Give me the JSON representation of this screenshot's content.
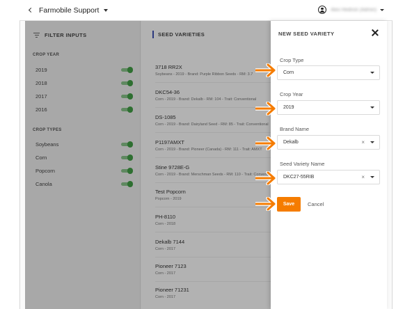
{
  "topbar": {
    "title": "Farmobile Support",
    "user_name": "Alex Hedrick (Admin)"
  },
  "sidebar": {
    "title": "FILTER INPUTS",
    "crop_year_label": "CROP YEAR",
    "crop_years": [
      "2019",
      "2018",
      "2017",
      "2016"
    ],
    "crop_types_label": "CROP TYPES",
    "crop_types": [
      "Soybeans",
      "Corn",
      "Popcorn",
      "Canola"
    ]
  },
  "main": {
    "title": "SEED VARIETIES",
    "varieties": [
      {
        "name": "3718 RR2X",
        "detail": "Soybeans - 2019 - Brand: Purple Ribbon Seeds - RM: 3.7"
      },
      {
        "name": "DKC54-36",
        "detail": "Corn - 2019 - Brand: Dekalb - RM: 104 - Trait: Conventional"
      },
      {
        "name": "DS-1085",
        "detail": "Corn - 2019 - Brand: Dairyland Seed - RM: 85 - Trait: Conventional"
      },
      {
        "name": "P1197AMXT",
        "detail": "Corn - 2019 - Brand: Pioneer (Canada) - RM: 111 - Trait: AMXT"
      },
      {
        "name": "Stine 9728E-G",
        "detail": "Corn - 2019 - Brand: Merschman Seeds - RM: 110 - Trait: Conventional"
      },
      {
        "name": "Test Popcorn",
        "detail": "Popcorn - 2019"
      },
      {
        "name": "PH-8110",
        "detail": "Corn - 2018"
      },
      {
        "name": "Dekalb 7144",
        "detail": "Corn - 2017"
      },
      {
        "name": "Pioneer 7123",
        "detail": "Corn - 2017"
      },
      {
        "name": "Pioneer 71231",
        "detail": "Corn - 2017"
      }
    ]
  },
  "panel": {
    "title": "NEW SEED VARIETY",
    "crop_type_label": "Crop Type",
    "crop_type_value": "Corn",
    "crop_year_label": "Crop Year",
    "crop_year_value": "2019",
    "brand_label": "Brand Name",
    "brand_value": "Dekalb",
    "variety_label": "Seed Variety Name",
    "variety_value": "DKC27-55RIB",
    "clear_glyph": "×",
    "save_label": "Save",
    "cancel_label": "Cancel"
  },
  "colors": {
    "accent": "#f57c00",
    "toggle_on": "#43a047",
    "header_bar": "#3f51b5"
  }
}
